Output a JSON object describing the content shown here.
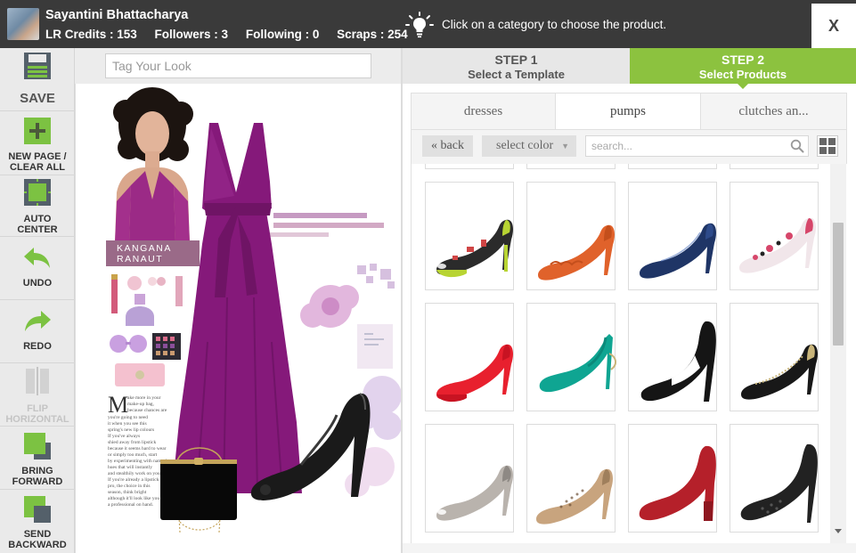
{
  "user": {
    "name": "Sayantini Bhattacharya",
    "stats": [
      "LR Credits : 153",
      "Followers : 3",
      "Following : 0",
      "Scraps : 254"
    ]
  },
  "hint": "Click on a category to choose the product.",
  "close_label": "X",
  "toolbar": {
    "save": "SAVE",
    "new_page": "NEW PAGE /",
    "clear_all": "CLEAR ALL",
    "auto": "AUTO",
    "center": "CENTER",
    "undo": "UNDO",
    "redo": "REDO",
    "flip": "FLIP",
    "horizontal": "HORIZONTAL",
    "bring": "BRING",
    "forward": "FORWARD",
    "send": "SEND",
    "backward": "BACKWARD"
  },
  "tag_placeholder": "Tag Your Look",
  "canvas": {
    "label_line1": "KANGANA",
    "label_line2": "RANAUT",
    "article": [
      "ake more in your",
      "make-up bag,",
      "because chances are",
      "you're going to need",
      "it when you see this",
      "spring's new lip colours",
      "If you've always",
      "shied away from lipstick",
      "because it seems hard to wear",
      "or simply too much, start",
      "by experimenting with natural",
      "hues that will instantly",
      "and stealthily work on your",
      "If you're already a lipstick",
      "pro, the choice in this",
      "season, think bright",
      "although it'll look like you",
      "a professional on hand."
    ]
  },
  "steps": {
    "step1_title": "STEP 1",
    "step1_sub": "Select a Template",
    "step2_title": "STEP 2",
    "step2_sub": "Select Products",
    "active": 2
  },
  "categories": [
    "dresses",
    "pumps",
    "clutches an..."
  ],
  "active_category": 1,
  "filter": {
    "back": "back",
    "back_icon": "«",
    "color_select": "select color",
    "search_placeholder": "search..."
  },
  "products": [
    {
      "name": "printed peep-toe platform pump",
      "colors": [
        "#2b2b2b",
        "#b8d433",
        "#d04545"
      ]
    },
    {
      "name": "orange scalloped pump",
      "colors": [
        "#e0622b",
        "#c44f1c"
      ]
    },
    {
      "name": "navy patent pump",
      "colors": [
        "#1f3566",
        "#2e4b8a"
      ]
    },
    {
      "name": "floral print kitten heel",
      "colors": [
        "#f1e6ea",
        "#d6466a",
        "#222222"
      ]
    },
    {
      "name": "red suede pump",
      "colors": [
        "#e8202e",
        "#c81322"
      ]
    },
    {
      "name": "teal slingback",
      "colors": [
        "#0fa592",
        "#0b8a7a"
      ]
    },
    {
      "name": "black cut-out heel",
      "colors": [
        "#151515",
        "#303030"
      ]
    },
    {
      "name": "black embellished pump",
      "colors": [
        "#181818",
        "#c9b57a"
      ]
    },
    {
      "name": "silver metallic peep-toe",
      "colors": [
        "#b9b3ad",
        "#8e8984"
      ]
    },
    {
      "name": "beige laser-cut pump",
      "colors": [
        "#c8a47e",
        "#9f7f5c"
      ]
    },
    {
      "name": "red patent block heel",
      "colors": [
        "#b5202a",
        "#8e1720"
      ]
    },
    {
      "name": "black glitter stiletto",
      "colors": [
        "#222222",
        "#555555"
      ]
    }
  ],
  "colors": {
    "topbar": "#3a3a3a",
    "accent_green": "#8cc23f",
    "toolbar_bg": "#eaeaea",
    "tool_green": "#7cc242"
  }
}
